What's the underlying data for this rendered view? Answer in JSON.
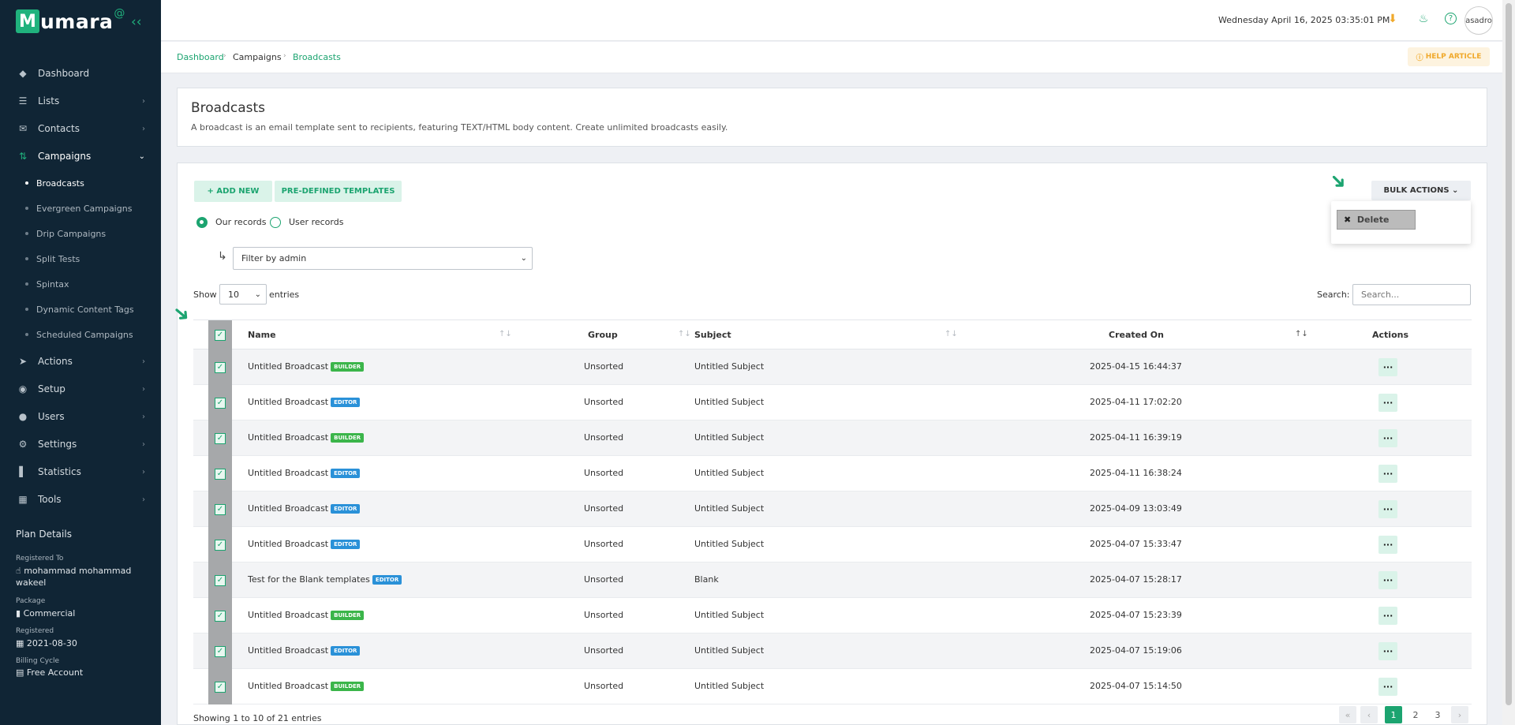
{
  "brand": {
    "logo_letter": "M",
    "logo_text": "umara",
    "logo_at": "@"
  },
  "sidebar": {
    "items": [
      {
        "label": "Dashboard",
        "icon": "layers-icon"
      },
      {
        "label": "Lists",
        "icon": "list-icon"
      },
      {
        "label": "Contacts",
        "icon": "envelope-icon"
      },
      {
        "label": "Campaigns",
        "icon": "shuffle-icon"
      },
      {
        "label": "Actions",
        "icon": "send-icon"
      },
      {
        "label": "Setup",
        "icon": "toggle-icon"
      },
      {
        "label": "Users",
        "icon": "user-icon"
      },
      {
        "label": "Settings",
        "icon": "gear-icon"
      },
      {
        "label": "Statistics",
        "icon": "bar-chart-icon"
      },
      {
        "label": "Tools",
        "icon": "grid-icon"
      }
    ],
    "sub_items": [
      {
        "label": "Broadcasts"
      },
      {
        "label": "Evergreen Campaigns"
      },
      {
        "label": "Drip Campaigns"
      },
      {
        "label": "Split Tests"
      },
      {
        "label": "Spintax"
      },
      {
        "label": "Dynamic Content Tags"
      },
      {
        "label": "Scheduled Campaigns"
      }
    ],
    "plan": {
      "title": "Plan Details",
      "registered_to_label": "Registered To",
      "registered_to": "mohammad mohammad wakeel",
      "package_label": "Package",
      "package": "Commercial",
      "registered_label": "Registered",
      "registered": "2021-08-30",
      "billing_label": "Billing Cycle",
      "billing": "Free Account"
    }
  },
  "topbar": {
    "datetime": "Wednesday April 16, 2025 03:35:01 PM",
    "avatar_text": "asadro"
  },
  "breadcrumb": {
    "items": [
      "Dashboard",
      "Campaigns",
      "Broadcasts"
    ],
    "help": "HELP ARTICLE"
  },
  "header": {
    "title": "Broadcasts",
    "description": "A broadcast is an email template sent to recipients, featuring TEXT/HTML body content. Create unlimited broadcasts easily."
  },
  "toolbar": {
    "add_new": "ADD NEW",
    "predefined": "PRE-DEFINED TEMPLATES",
    "bulk_actions": "BULK ACTIONS",
    "delete": "Delete",
    "radio_ours": "Our records",
    "radio_users": "User records",
    "filter": "Filter by admin",
    "show_label": "Show",
    "show_value": "10",
    "entries_label": "entries",
    "search_label": "Search:",
    "search_placeholder": "Search..."
  },
  "table": {
    "headers": {
      "name": "Name",
      "group": "Group",
      "subject": "Subject",
      "created": "Created On",
      "actions": "Actions"
    },
    "rows": [
      {
        "name": "Untitled Broadcast",
        "badge": "BUILDER",
        "group": "Unsorted",
        "subject": "Untitled Subject",
        "created": "2025-04-15 16:44:37"
      },
      {
        "name": "Untitled Broadcast",
        "badge": "EDITOR",
        "group": "Unsorted",
        "subject": "Untitled Subject",
        "created": "2025-04-11 17:02:20"
      },
      {
        "name": "Untitled Broadcast",
        "badge": "BUILDER",
        "group": "Unsorted",
        "subject": "Untitled Subject",
        "created": "2025-04-11 16:39:19"
      },
      {
        "name": "Untitled Broadcast",
        "badge": "EDITOR",
        "group": "Unsorted",
        "subject": "Untitled Subject",
        "created": "2025-04-11 16:38:24"
      },
      {
        "name": "Untitled Broadcast",
        "badge": "EDITOR",
        "group": "Unsorted",
        "subject": "Untitled Subject",
        "created": "2025-04-09 13:03:49"
      },
      {
        "name": "Untitled Broadcast",
        "badge": "EDITOR",
        "group": "Unsorted",
        "subject": "Untitled Subject",
        "created": "2025-04-07 15:33:47"
      },
      {
        "name": "Test for the Blank templates",
        "badge": "EDITOR",
        "group": "Unsorted",
        "subject": "Blank",
        "created": "2025-04-07 15:28:17"
      },
      {
        "name": "Untitled Broadcast",
        "badge": "BUILDER",
        "group": "Unsorted",
        "subject": "Untitled Subject",
        "created": "2025-04-07 15:23:39"
      },
      {
        "name": "Untitled Broadcast",
        "badge": "EDITOR",
        "group": "Unsorted",
        "subject": "Untitled Subject",
        "created": "2025-04-07 15:19:06"
      },
      {
        "name": "Untitled Broadcast",
        "badge": "BUILDER",
        "group": "Unsorted",
        "subject": "Untitled Subject",
        "created": "2025-04-07 15:14:50"
      }
    ],
    "actions_glyph": "···",
    "showing": "Showing 1 to 10 of 21 entries",
    "pages": [
      "1",
      "2",
      "3"
    ]
  },
  "colors": {
    "accent": "#1ca470",
    "sidebar_bg": "#102535",
    "builder": "#3bb54a",
    "editor": "#2a91d8"
  }
}
